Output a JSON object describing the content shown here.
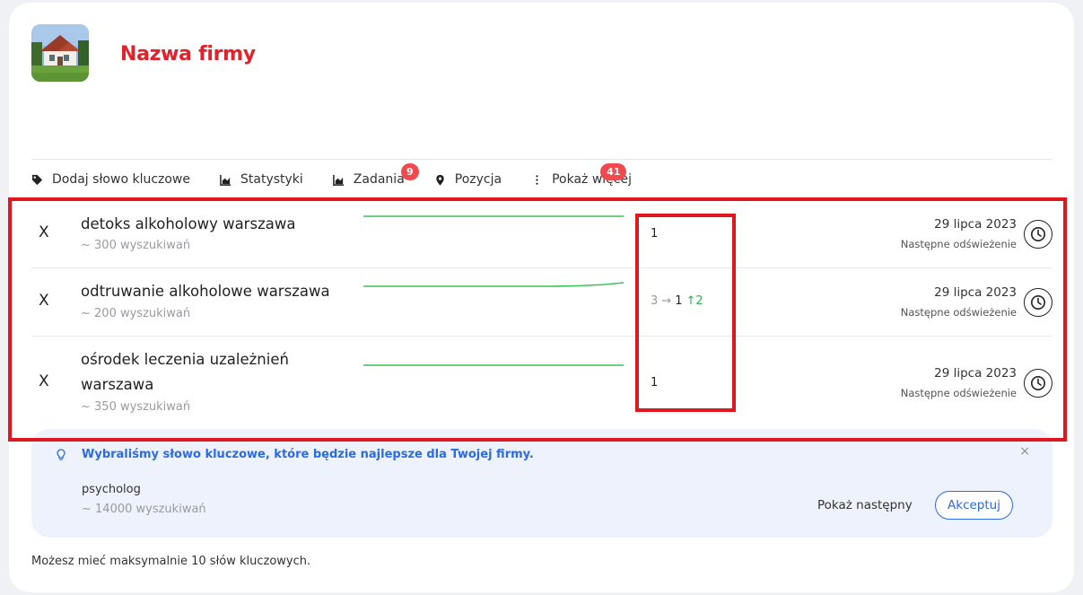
{
  "company": {
    "name": "Nazwa firmy"
  },
  "toolbar": {
    "add_keyword": "Dodaj słowo kluczowe",
    "stats": "Statystyki",
    "tasks": "Zadania",
    "tasks_badge": "9",
    "position": "Pozycja",
    "more": "Pokaż więcej",
    "more_badge": "41"
  },
  "keywords": [
    {
      "remove": "X",
      "name": "detoks alkoholowy warszawa",
      "searches": "~ 300 wyszukiwań",
      "position": "1",
      "date": "29 lipca 2023",
      "refresh_label": "Następne odświeżenie"
    },
    {
      "remove": "X",
      "name": "odtruwanie alkoholowe warszawa",
      "searches": "~ 200 wyszukiwań",
      "position_old": "3",
      "position_arrow": "→",
      "position_new": "1",
      "position_gain": "↑2",
      "date": "29 lipca 2023",
      "refresh_label": "Następne odświeżenie"
    },
    {
      "remove": "X",
      "name": "ośrodek leczenia uzależnień warszawa",
      "searches": "~ 350 wyszukiwań",
      "position": "1",
      "date": "29 lipca 2023",
      "refresh_label": "Następne odświeżenie"
    }
  ],
  "suggestion": {
    "message": "Wybraliśmy słowo kluczowe, które będzie najlepsze dla Twojej firmy.",
    "close": "×",
    "keyword": "psycholog",
    "searches": "~ 14000 wyszukiwań",
    "next_label": "Pokaż następny",
    "accept_label": "Akceptuj"
  },
  "footer": {
    "note": "Możesz mieć maksymalnie 10 słów kluczowych."
  },
  "colors": {
    "brand": "#e4202a",
    "accent": "#2b6be6",
    "positive": "#2fb34d",
    "badge": "#f04a4f",
    "annotation": "#e0171f"
  }
}
